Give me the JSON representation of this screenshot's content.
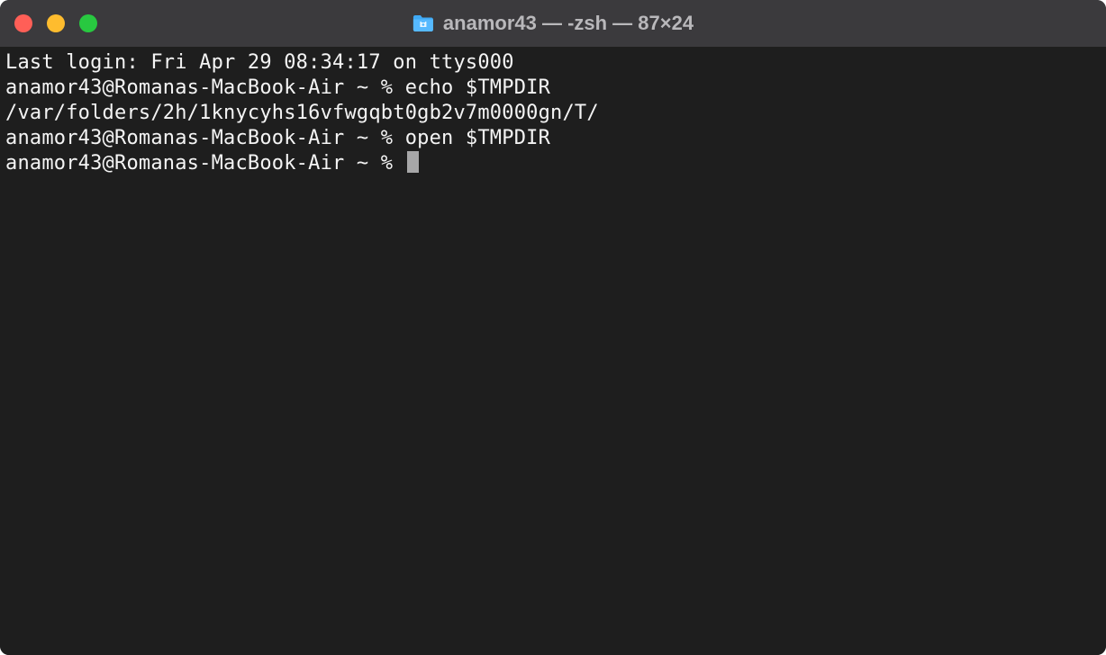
{
  "window": {
    "title": "anamor43 — -zsh — 87×24"
  },
  "terminal": {
    "lines": [
      "Last login: Fri Apr 29 08:34:17 on ttys000",
      "anamor43@Romanas-MacBook-Air ~ % echo $TMPDIR",
      "/var/folders/2h/1knycyhs16vfwgqbt0gb2v7m0000gn/T/",
      "anamor43@Romanas-MacBook-Air ~ % open $TMPDIR",
      "anamor43@Romanas-MacBook-Air ~ % "
    ]
  }
}
